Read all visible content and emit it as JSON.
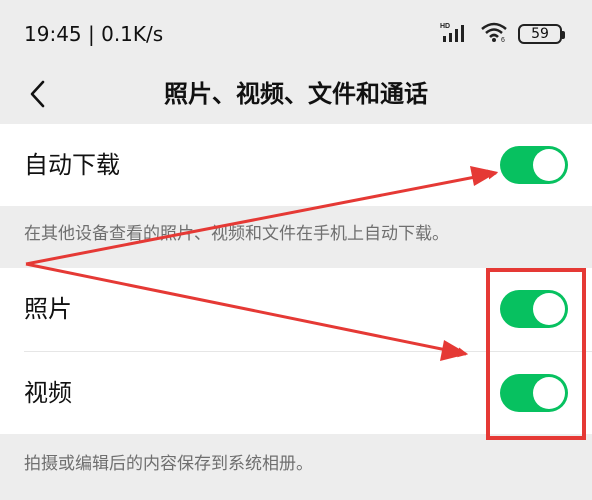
{
  "status_bar": {
    "time": "19:45 | 0.1K/s",
    "battery": "59",
    "signal_icon": "signal-icon",
    "wifi_icon": "wifi-icon"
  },
  "nav": {
    "back_icon": "chevron-left-icon",
    "title": "照片、视频、文件和通话"
  },
  "auto_download": {
    "label": "自动下载",
    "enabled": true,
    "description": "在其他设备查看的照片、视频和文件在手机上自动下载。"
  },
  "save_media": {
    "items": [
      {
        "label": "照片",
        "enabled": true
      },
      {
        "label": "视频",
        "enabled": true
      }
    ],
    "description": "拍摄或编辑后的内容保存到系统相册。"
  },
  "annotation": {
    "color": "#e53935"
  },
  "colors": {
    "toggle_on": "#07c160",
    "background": "#ededed",
    "card": "#ffffff",
    "secondary_text": "#6f6f6f"
  }
}
